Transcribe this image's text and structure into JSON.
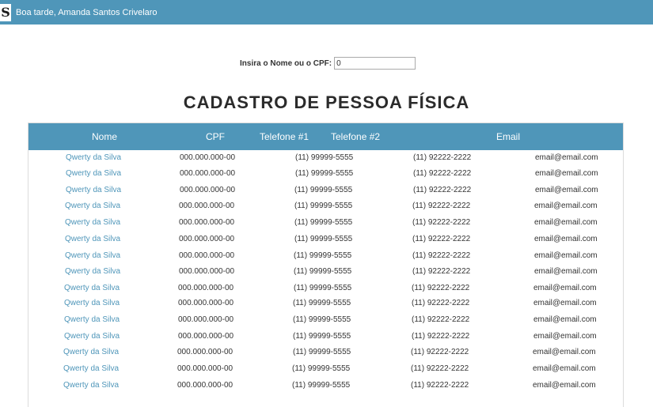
{
  "header": {
    "logo_text": "S",
    "greeting": "Boa tarde, Amanda Santos Crivelaro"
  },
  "search": {
    "label": "Insira o Nome ou o CPF:",
    "value": "0"
  },
  "page_title": "CADASTRO DE PESSOA FÍSICA",
  "table": {
    "columns": [
      "Nome",
      "CPF",
      "Telefone #1",
      "Telefone #2",
      "Email"
    ],
    "rows": [
      [
        "Qwerty da Silva",
        "000.000.000-00",
        "(11) 99999-5555",
        "(11) 92222-2222",
        "email@email.com"
      ],
      [
        "Qwerty da Silva",
        "000.000.000-00",
        "(11) 99999-5555",
        "(11) 92222-2222",
        "email@email.com"
      ],
      [
        "Qwerty da Silva",
        "000.000.000-00",
        "(11) 99999-5555",
        "(11) 92222-2222",
        "email@email.com"
      ],
      [
        "Qwerty da Silva",
        "000.000.000-00",
        "(11) 99999-5555",
        "(11) 92222-2222",
        "email@email.com"
      ],
      [
        "Qwerty da Silva",
        "000.000.000-00",
        "(11) 99999-5555",
        "(11) 92222-2222",
        "email@email.com"
      ],
      [
        "Qwerty da Silva",
        "000.000.000-00",
        "(11) 99999-5555",
        "(11) 92222-2222",
        "email@email.com"
      ],
      [
        "Qwerty da Silva",
        "000.000.000-00",
        "(11) 99999-5555",
        "(11) 92222-2222",
        "email@email.com"
      ],
      [
        "Qwerty da Silva",
        "000.000.000-00",
        "(11) 99999-5555",
        "(11) 92222-2222",
        "email@email.com"
      ],
      [
        "Qwerty da Silva",
        "000.000.000-00",
        "(11) 99999-5555",
        "(11) 92222-2222",
        "email@email.com"
      ],
      [
        "Qwerty da Silva",
        "000.000.000-00",
        "(11) 99999-5555",
        "(11) 92222-2222",
        "email@email.com"
      ],
      [
        "Qwerty da Silva",
        "000.000.000-00",
        "(11) 99999-5555",
        "(11) 92222-2222",
        "email@email.com"
      ],
      [
        "Qwerty da Silva",
        "000.000.000-00",
        "(11) 99999-5555",
        "(11) 92222-2222",
        "email@email.com"
      ],
      [
        "Qwerty da Silva",
        "000.000.000-00",
        "(11) 99999-5555",
        "(11) 92222-2222",
        "email@email.com"
      ],
      [
        "Qwerty da Silva",
        "000.000.000-00",
        "(11) 99999-5555",
        "(11) 92222-2222",
        "email@email.com"
      ],
      [
        "Qwerty da Silva",
        "000.000.000-00",
        "(11) 99999-5555",
        "(11) 92222-2222",
        "email@email.com"
      ]
    ]
  },
  "colors": {
    "accent": "#4f96b9",
    "link": "#4f96b9"
  }
}
